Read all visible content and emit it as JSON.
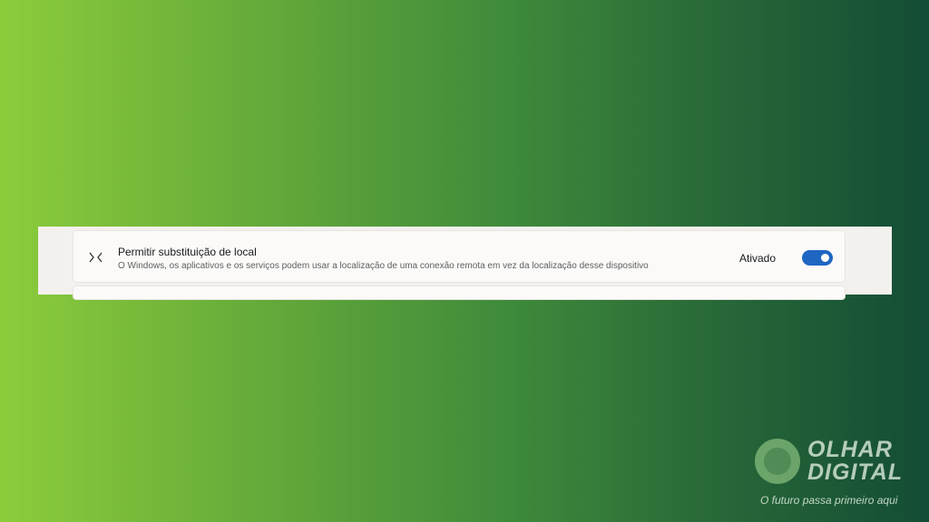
{
  "setting": {
    "icon": "remote-location-icon",
    "title": "Permitir substituição de local",
    "description": "O Windows, os aplicativos e os serviços podem usar a localização de uma conexão remota em vez da localização desse dispositivo",
    "state_label": "Ativado",
    "toggle_on": true,
    "accent_color": "#1f66c2"
  },
  "watermark": {
    "brand_line1": "OLHAR",
    "brand_line2": "DIGITAL",
    "tagline": "O futuro passa primeiro aqui"
  }
}
